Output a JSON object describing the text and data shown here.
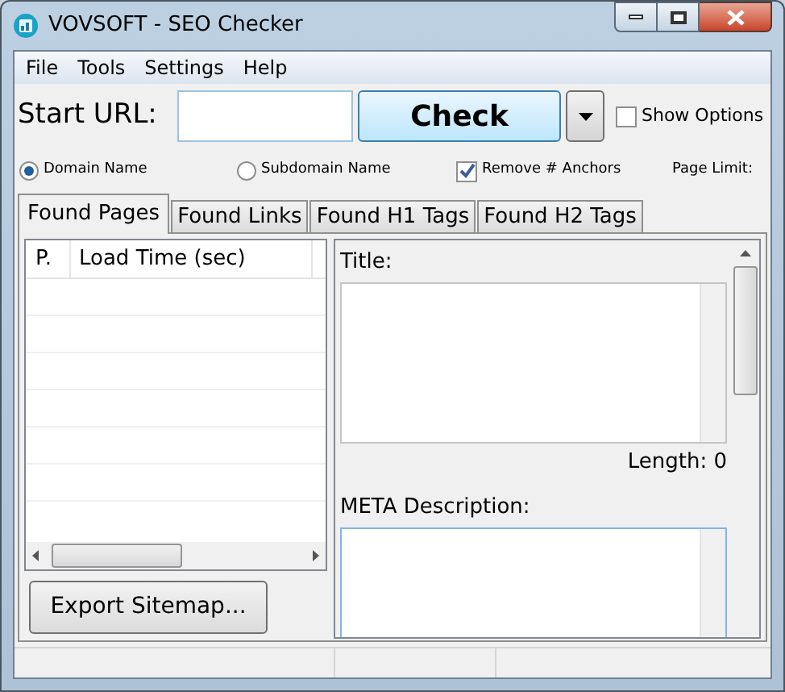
{
  "window": {
    "title": "VOVSOFT - SEO Checker"
  },
  "menu": [
    "File",
    "Tools",
    "Settings",
    "Help"
  ],
  "toolbar": {
    "url_label": "Start URL:",
    "check_button": "Check",
    "show_options": {
      "label": "Show Options",
      "checked": false
    }
  },
  "options": [
    {
      "kind": "radio",
      "label": "Domain Name",
      "selected": true
    },
    {
      "kind": "radio",
      "label": "Subdomain Name",
      "selected": false
    },
    {
      "kind": "checkbox",
      "label": "Remove # Anchors",
      "checked": true
    },
    {
      "kind": "label",
      "label": "Page Limit:"
    }
  ],
  "tabs": [
    {
      "label": "Found Pages",
      "selected": true
    },
    {
      "label": "Found Links",
      "selected": false
    },
    {
      "label": "Found H1 Tags",
      "selected": false
    },
    {
      "label": "Found H2 Tags",
      "selected": false
    }
  ],
  "table": {
    "columns": [
      "P.",
      "Load Time (sec)"
    ]
  },
  "export_button": "Export Sitemap...",
  "details": {
    "title_label": "Title:",
    "length": "Length: 0",
    "meta_label": "META Description:"
  }
}
